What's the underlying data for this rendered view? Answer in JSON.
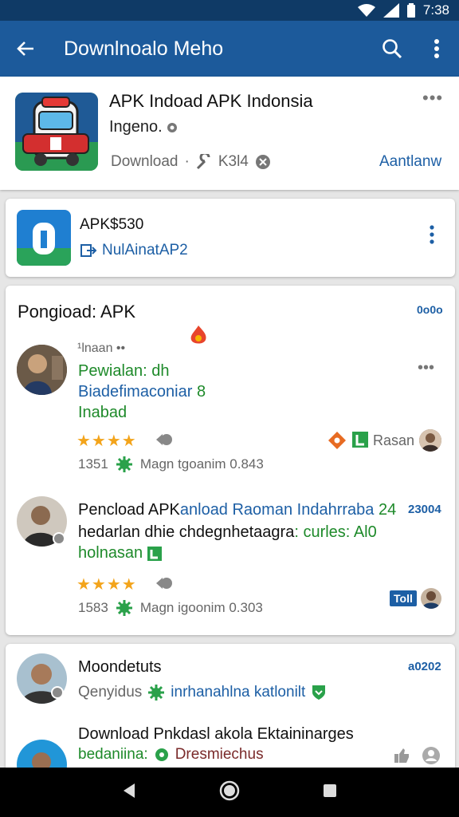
{
  "status": {
    "time": "7:38"
  },
  "appbar": {
    "title": "Downlnoalo Meho"
  },
  "header_app": {
    "name": "APK Indoad APK Indonsia",
    "subtitle": "Ingeno. ",
    "download_label": "Download",
    "separator": "·",
    "size": "K3l4",
    "action": "Aantlanw"
  },
  "app2": {
    "name": "APK$530",
    "link": "NulAinatAP2"
  },
  "section": {
    "title": "Pongioad: APK",
    "corner": "0o0o",
    "reviews": [
      {
        "author": "¹lnaan ••",
        "line1": "Pewialan: dh",
        "line2": "Biadefimaconiar",
        "line2_mark": "8",
        "line3": "Inabad",
        "rating": "★★★★",
        "meta_count": "1351",
        "meta_text": "Magn tgoanim 0.843",
        "right_label": "Rasan"
      },
      {
        "line1_black": "Pencload APK",
        "line1_blue": "anload Raoman Indahrraba",
        "line1_green": "24",
        "line2_black": "hedarlan dhie chdegnhetaagra",
        "line2_green": ": curles: Al0",
        "line3": "holnasan",
        "corner": "23004",
        "rating": "★★★★",
        "meta_count": "1583",
        "meta_text": "Magn igoonim 0.303",
        "badge": "Toll"
      }
    ]
  },
  "bottom_card": {
    "corner": "a0202",
    "item1": {
      "title": "Moondetuts",
      "sub_gray": "Qenyidus",
      "sub_blue": "inrhanahlna katlonilt"
    },
    "item2": {
      "title": "Download Pnkdasl akola Ektaininarges",
      "sub_green": "bedaniina:",
      "sub_dark": "Dresmiechus"
    }
  },
  "colors": {
    "appbar": "#1c5a9b",
    "status": "#0f3a66",
    "star": "#f3a41b",
    "green": "#1e8a2a",
    "link_blue": "#1d5fa5"
  }
}
